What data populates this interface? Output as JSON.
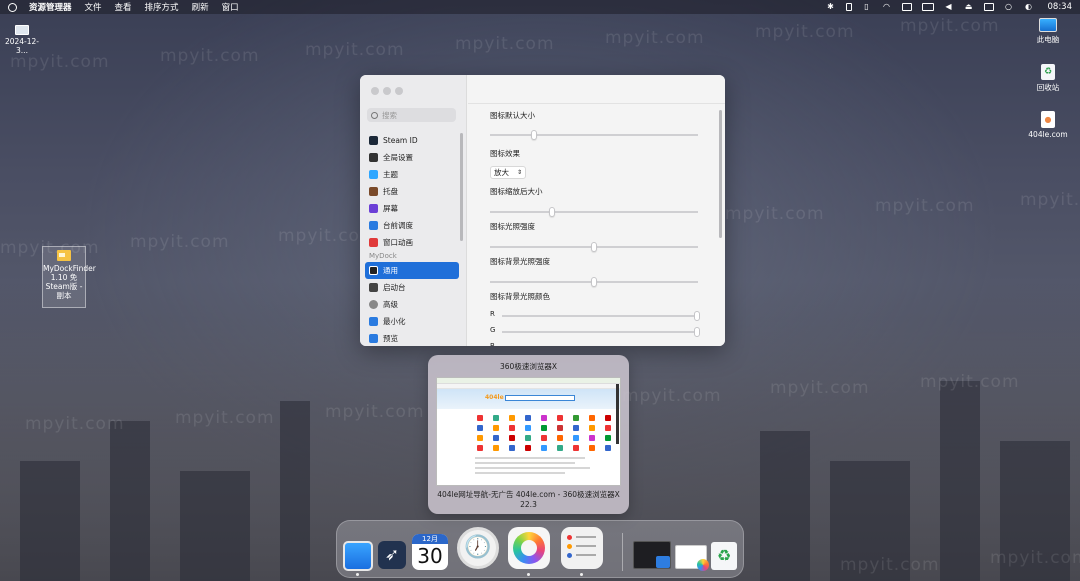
{
  "menubar": {
    "app": "资源管理器",
    "menus": [
      "文件",
      "查看",
      "排序方式",
      "刷新",
      "窗口"
    ],
    "time": "08:34",
    "status_icons": [
      "bluetooth-icon",
      "battery-icon",
      "phone-icon",
      "wifi-icon",
      "display-icon",
      "vr-icon",
      "volume-icon",
      "eject-icon",
      "user-icon",
      "search-icon",
      "control-center-icon"
    ]
  },
  "desktop": {
    "left_icon_label": "2024-12-3...",
    "selected_file_label": "MyDockFinder 1.10 免Steam版 - 副本",
    "right_icons": [
      {
        "label": "此电脑",
        "icon": "monitor-icon"
      },
      {
        "label": "回收站",
        "icon": "recycle-bin-icon"
      },
      {
        "label": "404le.com",
        "icon": "web-file-icon"
      }
    ],
    "watermark": "mpyit.com"
  },
  "settings": {
    "search_placeholder": "搜索",
    "nav_items": [
      {
        "label": "Steam ID",
        "icon": "steam-icon",
        "color": "#1b2838"
      },
      {
        "label": "全局设置",
        "icon": "settings-icon",
        "color": "#333333"
      },
      {
        "label": "主题",
        "icon": "theme-icon",
        "color": "#2ea6ff"
      },
      {
        "label": "托盘",
        "icon": "tray-icon",
        "color": "#7a4a2a"
      },
      {
        "label": "屏幕",
        "icon": "screen-icon",
        "color": "#6b3fd6"
      },
      {
        "label": "台前调度",
        "icon": "stage-icon",
        "color": "#2a7be0"
      },
      {
        "label": "窗口动画",
        "icon": "window-anim-icon",
        "color": "#e03a3a"
      }
    ],
    "section_label": "MyDock",
    "dock_items": [
      {
        "label": "通用",
        "icon": "general-icon",
        "color": "#222222",
        "active": true
      },
      {
        "label": "启动台",
        "icon": "launchpad-icon",
        "color": "#444444"
      },
      {
        "label": "高级",
        "icon": "advanced-icon",
        "color": "#666666"
      },
      {
        "label": "最小化",
        "icon": "minimize-icon",
        "color": "#2a7be0"
      },
      {
        "label": "预览",
        "icon": "preview-icon",
        "color": "#2a7be0"
      }
    ],
    "labels": {
      "icon_size": "图标默认大小",
      "icon_effect": "图标效果",
      "effect_value": "放大",
      "zoom_size": "图标缩放后大小",
      "light": "图标光照强度",
      "bg_light": "图标背景光照强度",
      "bg_color": "图标背景光照颜色",
      "r": "R",
      "g": "G",
      "b": "B"
    },
    "slider_values": {
      "icon_size": 0.21,
      "zoom_size": 0.3,
      "light": 0.5,
      "bg_light": 0.5,
      "r": 1.0,
      "g": 1.0
    }
  },
  "preview": {
    "title": "360极速浏览器X",
    "caption": "404le网址导航-无广告 404le.com - 360极速浏览器X 22.3",
    "thumb_brand": "404le"
  },
  "dock": {
    "calendar_month": "12月",
    "calendar_day": "30",
    "clock_glyph": "🕖",
    "apps": [
      "finder-icon",
      "rocket-icon",
      "calendar-icon",
      "clock-icon",
      "chrome-icon",
      "reminders-icon",
      "terminal-icon",
      "browser-icon",
      "recycle-bin-icon"
    ]
  }
}
